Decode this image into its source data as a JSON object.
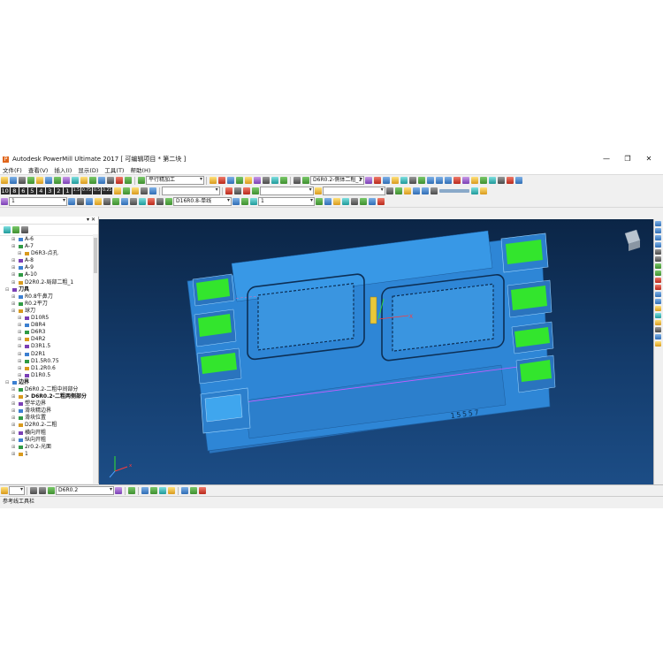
{
  "window": {
    "title": "Autodesk PowerMill Ultimate 2017   [ 可编辑项目 * 第二块 ]",
    "controls": [
      "—",
      "❐",
      "✕"
    ]
  },
  "menu": [
    "文件(F)",
    "查看(V)",
    "插入(I)",
    "显示(D)",
    "工具(T)",
    "帮助(H)"
  ],
  "toolbar1": {
    "strategy_combo": "平行精加工",
    "toolpath_combo": "D6R0.2-侧体二粗_1",
    "values": [
      "10",
      "8",
      "6",
      "5",
      "4",
      "3",
      "2",
      "1",
      "1.5",
      "0.75",
      "0.5",
      "0.25"
    ]
  },
  "toolbar3": {
    "tool_combo": "1",
    "toolpath_combo": "D16R0.8-单线",
    "level_combo": "1"
  },
  "tree": {
    "items": [
      {
        "label": "A-6",
        "depth": 1
      },
      {
        "label": "A-7",
        "depth": 1
      },
      {
        "label": "D6R3-点孔",
        "depth": 2
      },
      {
        "label": "A-8",
        "depth": 1
      },
      {
        "label": "A-9",
        "depth": 1
      },
      {
        "label": "A-10",
        "depth": 1
      },
      {
        "label": "D2R0.2-局部二粗_1",
        "depth": 1
      },
      {
        "label": "刀具",
        "depth": 0,
        "bold": true
      },
      {
        "label": "R0.8牛鼻刀",
        "depth": 1
      },
      {
        "label": "R0.2平刀",
        "depth": 1
      },
      {
        "label": "球刀",
        "depth": 1
      },
      {
        "label": "D10R5",
        "depth": 2
      },
      {
        "label": "D8R4",
        "depth": 2
      },
      {
        "label": "D6R3",
        "depth": 2
      },
      {
        "label": "D4R2",
        "depth": 2
      },
      {
        "label": "D3R1.5",
        "depth": 2
      },
      {
        "label": "D2R1",
        "depth": 2
      },
      {
        "label": "D1.5R0.75",
        "depth": 2
      },
      {
        "label": "D1.2R0.6",
        "depth": 2
      },
      {
        "label": "D1R0.5",
        "depth": 2
      },
      {
        "label": "边界",
        "depth": 0,
        "bold": true
      },
      {
        "label": "D6R0.2-二粗中间部分",
        "depth": 1
      },
      {
        "label": "> D6R0.2-二粗两侧部分",
        "depth": 1,
        "active": true
      },
      {
        "label": "塑半边界",
        "depth": 1
      },
      {
        "label": "滑块精边界",
        "depth": 1
      },
      {
        "label": "滑块位置",
        "depth": 1
      },
      {
        "label": "D2R0.2-二粗",
        "depth": 1
      },
      {
        "label": "横向开粗",
        "depth": 1
      },
      {
        "label": "纵向开粗",
        "depth": 1
      },
      {
        "label": "2r0.2-光面",
        "depth": 1
      },
      {
        "label": "1",
        "depth": 1
      }
    ]
  },
  "viewport": {
    "engraving": "15557"
  },
  "bottombar": {
    "tool_combo": "D6R0.2"
  },
  "status": {
    "text": "参考线工具栏"
  },
  "colors": {
    "part_blue": "#2f86d6",
    "part_top": "#3ea0ee",
    "toolpath_green": "#33e52d",
    "background": "#123a67"
  }
}
